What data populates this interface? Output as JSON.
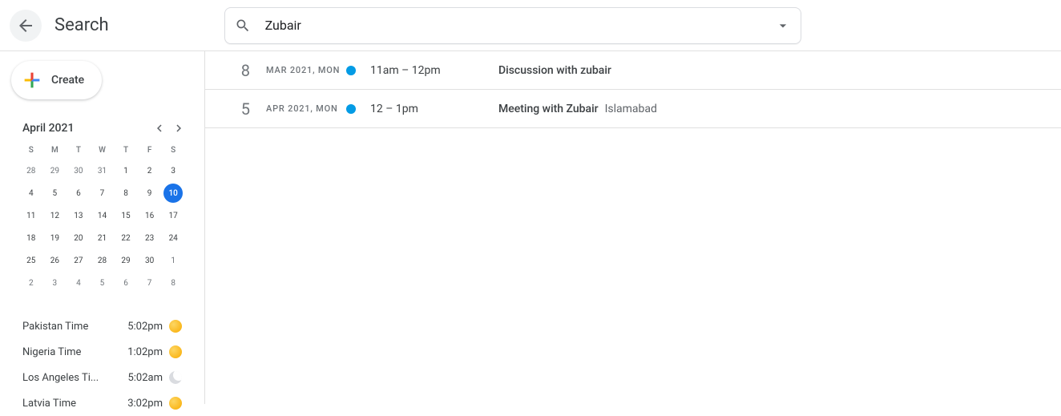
{
  "header": {
    "title": "Search",
    "search_value": "Zubair"
  },
  "sidebar": {
    "create_label": "Create",
    "calendar": {
      "title": "April 2021",
      "dow": [
        "S",
        "M",
        "T",
        "W",
        "T",
        "F",
        "S"
      ],
      "weeks": [
        [
          {
            "d": "28",
            "dim": true
          },
          {
            "d": "29",
            "dim": true
          },
          {
            "d": "30",
            "dim": true
          },
          {
            "d": "31",
            "dim": true
          },
          {
            "d": "1"
          },
          {
            "d": "2"
          },
          {
            "d": "3"
          }
        ],
        [
          {
            "d": "4"
          },
          {
            "d": "5"
          },
          {
            "d": "6"
          },
          {
            "d": "7"
          },
          {
            "d": "8"
          },
          {
            "d": "9"
          },
          {
            "d": "10",
            "today": true
          }
        ],
        [
          {
            "d": "11"
          },
          {
            "d": "12"
          },
          {
            "d": "13"
          },
          {
            "d": "14"
          },
          {
            "d": "15"
          },
          {
            "d": "16"
          },
          {
            "d": "17"
          }
        ],
        [
          {
            "d": "18"
          },
          {
            "d": "19"
          },
          {
            "d": "20"
          },
          {
            "d": "21"
          },
          {
            "d": "22"
          },
          {
            "d": "23"
          },
          {
            "d": "24"
          }
        ],
        [
          {
            "d": "25"
          },
          {
            "d": "26"
          },
          {
            "d": "27"
          },
          {
            "d": "28"
          },
          {
            "d": "29"
          },
          {
            "d": "30"
          },
          {
            "d": "1",
            "dim": true
          }
        ],
        [
          {
            "d": "2",
            "dim": true
          },
          {
            "d": "3",
            "dim": true
          },
          {
            "d": "4",
            "dim": true
          },
          {
            "d": "5",
            "dim": true
          },
          {
            "d": "6",
            "dim": true
          },
          {
            "d": "7",
            "dim": true
          },
          {
            "d": "8",
            "dim": true
          }
        ]
      ]
    },
    "clocks": [
      {
        "label": "Pakistan Time",
        "time": "5:02pm",
        "icon": "sun"
      },
      {
        "label": "Nigeria Time",
        "time": "1:02pm",
        "icon": "sun"
      },
      {
        "label": "Los Angeles Ti...",
        "time": "5:02am",
        "icon": "moon"
      },
      {
        "label": "Latvia Time",
        "time": "3:02pm",
        "icon": "sun"
      }
    ]
  },
  "results": [
    {
      "day": "8",
      "date": "MAR 2021, MON",
      "time": "11am – 12pm",
      "title": "Discussion with zubair",
      "location": ""
    },
    {
      "day": "5",
      "date": "APR 2021, MON",
      "time": "12 – 1pm",
      "title": "Meeting with Zubair",
      "location": "Islamabad"
    }
  ]
}
